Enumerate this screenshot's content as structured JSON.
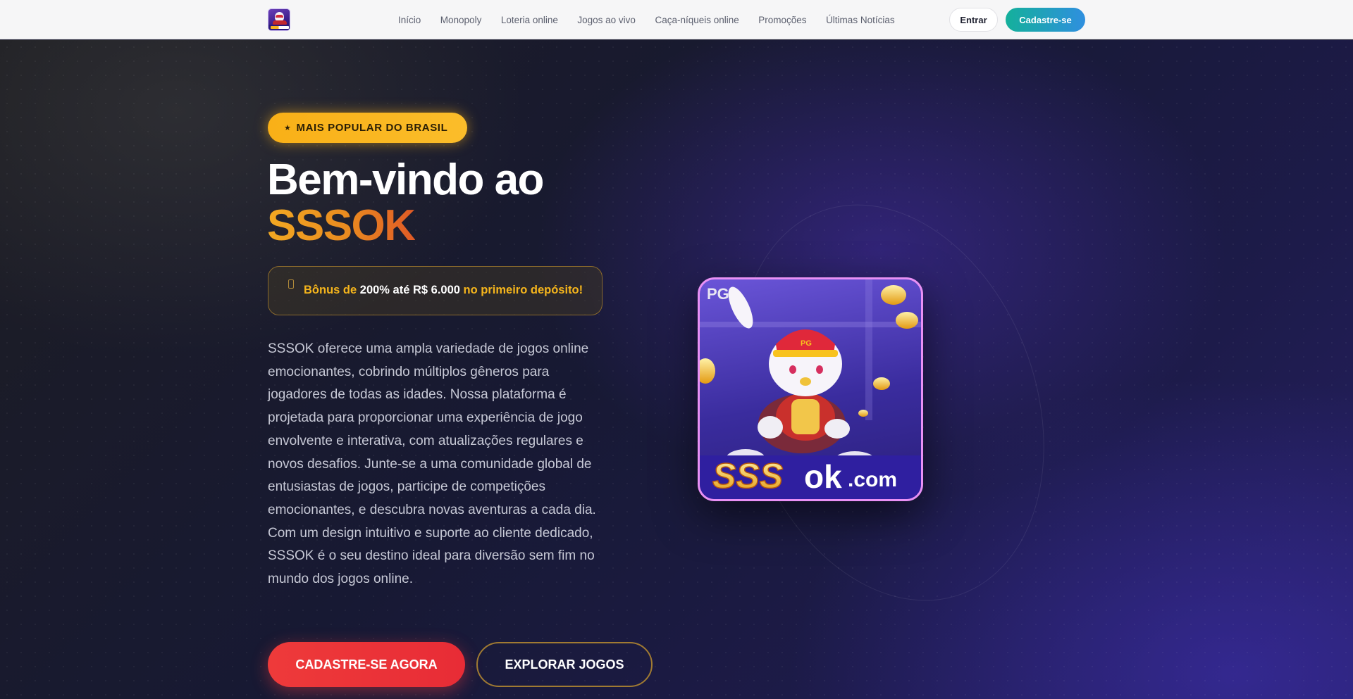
{
  "nav": {
    "items": [
      "Início",
      "Monopoly",
      "Loteria online",
      "Jogos ao vivo",
      "Caça-níqueis online",
      "Promoções",
      "Últimas Notícias"
    ],
    "login_label": "Entrar",
    "signup_label": "Cadastre-se"
  },
  "hero": {
    "badge": "MAIS POPULAR DO BRASIL",
    "title_line1": "Bem-vindo ao",
    "title_line2": "SSSOK",
    "bonus": {
      "prefix": "Bônus de",
      "amount": "200% até R$ 6.000",
      "suffix": "no primeiro depósito!"
    },
    "description": "SSSOK oferece uma ampla variedade de jogos online emocionantes, cobrindo múltiplos gêneros para jogadores de todas as idades. Nossa plataforma é projetada para proporcionar uma experiência de jogo envolvente e interativa, com atualizações regulares e novos desafios. Junte-se a uma comunidade global de entusiastas de jogos, participe de competições emocionantes, e descubra novas aventuras a cada dia. Com um design intuitivo e suporte ao cliente dedicado, SSSOK é o seu destino ideal para diversão sem fim no mundo dos jogos online.",
    "cta_primary": "CADASTRE-SE AGORA",
    "cta_secondary": "EXPLORAR JOGOS"
  },
  "game_card": {
    "provider": "PG",
    "brand_a": "SSS",
    "brand_b": "ok",
    "brand_c": ".com",
    "cap_text": "PG"
  },
  "colors": {
    "accent_gold": "#f9b017",
    "accent_red": "#ee3a3a",
    "signup_gradient_start": "#14b09b",
    "signup_gradient_end": "#2f8fdf"
  }
}
